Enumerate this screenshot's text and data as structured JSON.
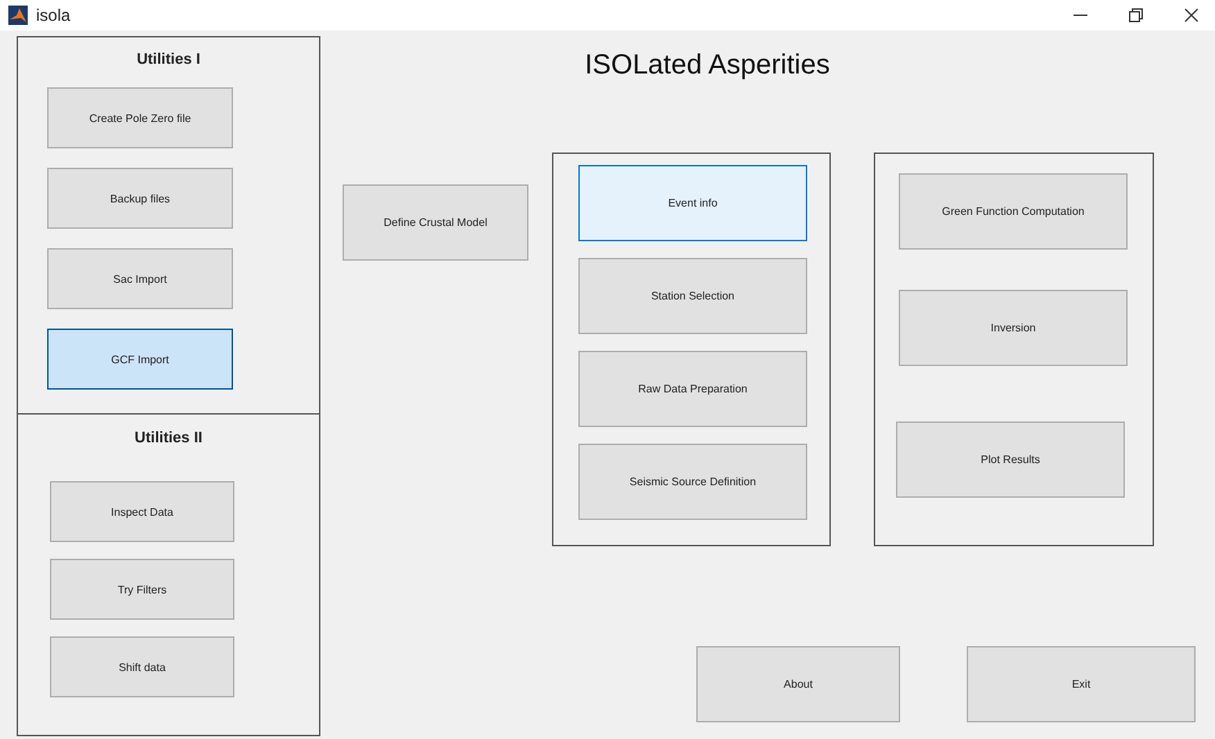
{
  "window": {
    "title": "isola"
  },
  "heading": "ISOLated Asperities",
  "panels": [
    {
      "title": "Utilities I",
      "buttons": [
        {
          "label": "Create Pole Zero file",
          "selected": false,
          "hovered": false
        },
        {
          "label": "Backup files",
          "selected": false,
          "hovered": false
        },
        {
          "label": "Sac Import",
          "selected": false,
          "hovered": false
        },
        {
          "label": "GCF Import",
          "selected": true,
          "hovered": false
        }
      ]
    },
    {
      "title": "Utilities II",
      "buttons": [
        {
          "label": "Inspect Data",
          "selected": false,
          "hovered": false
        },
        {
          "label": "Try Filters",
          "selected": false,
          "hovered": false
        },
        {
          "label": "Shift data",
          "selected": false,
          "hovered": false
        }
      ]
    },
    {
      "buttons": [
        {
          "label": "Event info",
          "selected": false,
          "hovered": true
        },
        {
          "label": "Station Selection",
          "selected": false,
          "hovered": false
        },
        {
          "label": "Raw Data Preparation",
          "selected": false,
          "hovered": false
        },
        {
          "label": "Seismic Source Definition",
          "selected": false,
          "hovered": false
        }
      ]
    },
    {
      "buttons": [
        {
          "label": "Green Function Computation",
          "selected": false,
          "hovered": false
        },
        {
          "label": "Inversion",
          "selected": false,
          "hovered": false
        },
        {
          "label": "Plot Results",
          "selected": false,
          "hovered": false
        }
      ]
    }
  ],
  "free_buttons": [
    {
      "label": "Define Crustal Model",
      "selected": false,
      "hovered": false
    },
    {
      "label": "About",
      "selected": false,
      "hovered": false
    },
    {
      "label": "Exit",
      "selected": false,
      "hovered": false
    }
  ]
}
